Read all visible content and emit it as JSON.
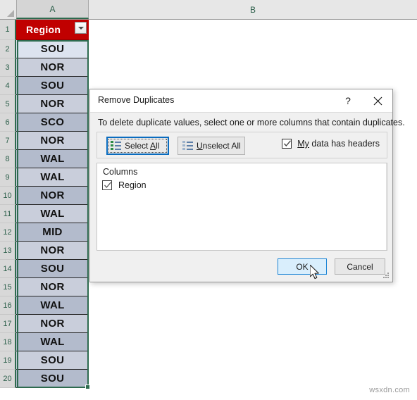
{
  "app": "excel-spreadsheet",
  "grid": {
    "column_headers": [
      {
        "label": "A",
        "selected": true
      },
      {
        "label": "B",
        "selected": false
      }
    ],
    "header_cell": {
      "row": "1",
      "value": "Region",
      "filter_icon": "filter-dropdown-icon",
      "bg_color": "#c00000",
      "text_color": "#ffffff"
    },
    "rows": [
      {
        "num": "2",
        "value": "SOU",
        "band": "band-light"
      },
      {
        "num": "3",
        "value": "NOR",
        "band": "band-mid"
      },
      {
        "num": "4",
        "value": "SOU",
        "band": "band-dark"
      },
      {
        "num": "5",
        "value": "NOR",
        "band": "band-mid"
      },
      {
        "num": "6",
        "value": "SCO",
        "band": "band-dark"
      },
      {
        "num": "7",
        "value": "NOR",
        "band": "band-mid"
      },
      {
        "num": "8",
        "value": "WAL",
        "band": "band-dark"
      },
      {
        "num": "9",
        "value": "WAL",
        "band": "band-mid"
      },
      {
        "num": "10",
        "value": "NOR",
        "band": "band-dark"
      },
      {
        "num": "11",
        "value": "WAL",
        "band": "band-mid"
      },
      {
        "num": "12",
        "value": "MID",
        "band": "band-dark"
      },
      {
        "num": "13",
        "value": "NOR",
        "band": "band-mid"
      },
      {
        "num": "14",
        "value": "SOU",
        "band": "band-dark"
      },
      {
        "num": "15",
        "value": "NOR",
        "band": "band-mid"
      },
      {
        "num": "16",
        "value": "WAL",
        "band": "band-dark"
      },
      {
        "num": "17",
        "value": "NOR",
        "band": "band-mid"
      },
      {
        "num": "18",
        "value": "WAL",
        "band": "band-dark"
      },
      {
        "num": "19",
        "value": "SOU",
        "band": "band-mid"
      },
      {
        "num": "20",
        "value": "SOU",
        "band": "band-dark"
      }
    ],
    "selection_range": "A2:A20"
  },
  "dialog": {
    "title": "Remove Duplicates",
    "help_label": "?",
    "close_icon": "close-icon",
    "instruction": "To delete duplicate values, select one or more columns that contain duplicates.",
    "select_all": {
      "label": "Select All",
      "accel": "A",
      "icon": "select-all-list-icon",
      "focused": true
    },
    "unselect_all": {
      "label": "Unselect All",
      "accel": "U",
      "icon": "unselect-all-list-icon",
      "focused": false
    },
    "my_data_has_headers": {
      "label": "My data has headers",
      "accel": "My",
      "checked": true
    },
    "columns_list": {
      "title": "Columns",
      "items": [
        {
          "label": "Region",
          "checked": true
        }
      ]
    },
    "ok_button": {
      "label": "OK",
      "default": true,
      "accent": "#1b85d6"
    },
    "cancel_button": {
      "label": "Cancel"
    },
    "resize_grip": "resize-grip-icon"
  },
  "cursor": {
    "icon": "mouse-pointer-icon",
    "over": "ok-button"
  },
  "watermark": "wsxdn.com"
}
